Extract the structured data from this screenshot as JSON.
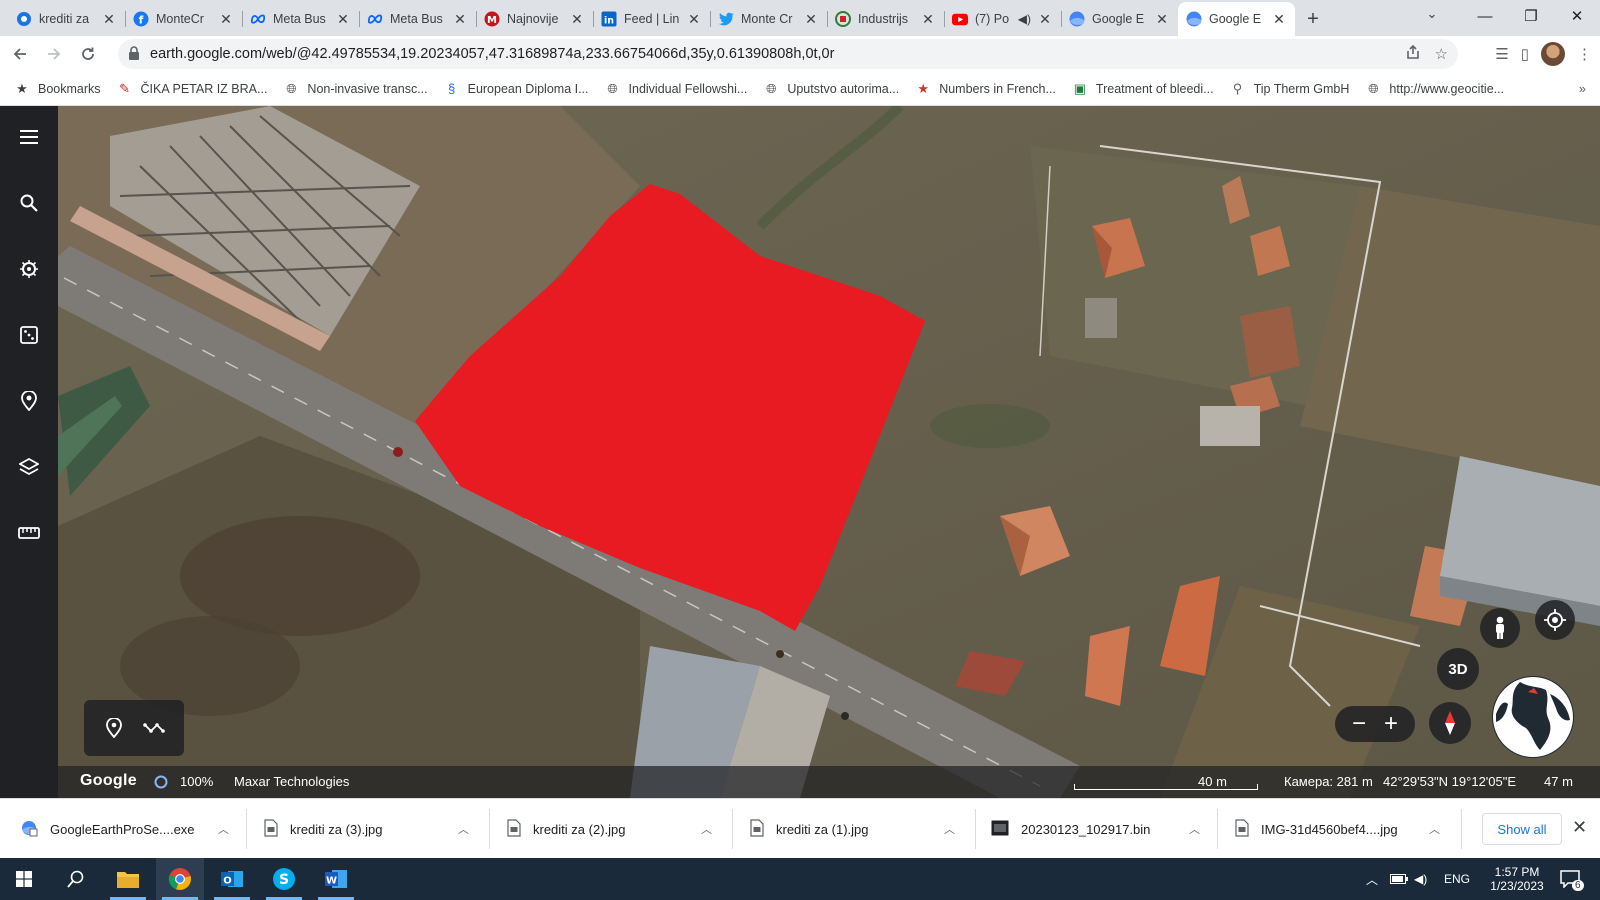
{
  "browser": {
    "tabs": [
      {
        "title": "krediti za",
        "icon": "chrome-icon",
        "color": "#1a73e8"
      },
      {
        "title": "MonteCr",
        "icon": "facebook-icon",
        "color": "#1877f2"
      },
      {
        "title": "Meta Bus",
        "icon": "meta-icon",
        "color": "#0866ff"
      },
      {
        "title": "Meta Bus",
        "icon": "meta-icon",
        "color": "#0866ff"
      },
      {
        "title": "Najnovije",
        "icon": "news-icon",
        "color": "#c4161c"
      },
      {
        "title": "Feed | Lin",
        "icon": "linkedin-icon",
        "color": "#0a66c2"
      },
      {
        "title": "Monte Cr",
        "icon": "twitter-icon",
        "color": "#1d9bf0"
      },
      {
        "title": "Industrijs",
        "icon": "industry-icon",
        "color": "#2e7d32"
      },
      {
        "title": "(7) Po",
        "icon": "youtube-icon",
        "color": "#ff0000",
        "audio": true
      },
      {
        "title": "Google E",
        "icon": "google-earth-icon",
        "color": "#4285f4"
      },
      {
        "title": "Google E",
        "icon": "google-earth-icon",
        "color": "#4285f4",
        "active": true
      }
    ],
    "url": "earth.google.com/web/@42.49785534,19.20234057,47.31689874a,233.66754066d,35y,0.61390808h,0t,0r",
    "bookmarks": [
      {
        "label": "Bookmarks",
        "icon": "star-icon"
      },
      {
        "label": "ČIKA PETAR IZ BRA...",
        "icon": "bookmark-app-icon"
      },
      {
        "label": "Non-invasive transc...",
        "icon": "globe-icon"
      },
      {
        "label": "European Diploma I...",
        "icon": "bookmark-app-icon"
      },
      {
        "label": "Individual Fellowshi...",
        "icon": "globe-icon"
      },
      {
        "label": "Uputstvo autorima...",
        "icon": "globe-icon"
      },
      {
        "label": "Numbers in French...",
        "icon": "bookmark-star-icon"
      },
      {
        "label": "Treatment of bleedi...",
        "icon": "bookmark-app-icon"
      },
      {
        "label": "Tip Therm GmbH",
        "icon": "bookmark-app-icon"
      },
      {
        "label": "http://www.geocitie...",
        "icon": "globe-icon"
      }
    ]
  },
  "earth": {
    "status": {
      "logo": "Google",
      "loading": "100%",
      "attribution": "Maxar Technologies",
      "scale": "40 m",
      "camera": "Камера: 281 m",
      "coords": "42°29'53\"N 19°12'05\"E",
      "elevation": "47 m"
    },
    "view_mode": "3D",
    "highlight_color": "#e81a22"
  },
  "downloads": {
    "items": [
      {
        "name": "GoogleEarthProSe....exe",
        "icon": "installer-icon"
      },
      {
        "name": "krediti za (3).jpg",
        "icon": "image-file-icon"
      },
      {
        "name": "krediti za (2).jpg",
        "icon": "image-file-icon"
      },
      {
        "name": "krediti za (1).jpg",
        "icon": "image-file-icon"
      },
      {
        "name": "20230123_102917.bin",
        "icon": "binary-file-icon"
      },
      {
        "name": "IMG-31d4560bef4....jpg",
        "icon": "image-file-icon"
      }
    ],
    "show_all": "Show all"
  },
  "taskbar": {
    "lang": "ENG",
    "time": "1:57 PM",
    "date": "1/23/2023",
    "notifications": "6"
  }
}
